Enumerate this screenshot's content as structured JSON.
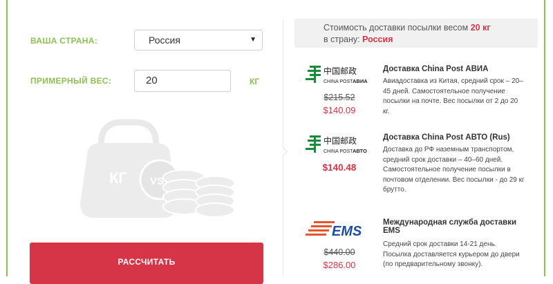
{
  "form": {
    "country_label": "ВАША СТРАНА:",
    "country_value": "Россия",
    "weight_label": "ПРИМЕРНЫЙ ВЕС:",
    "weight_value": "20",
    "weight_unit": "КГ",
    "calculate_label": "РАССЧИТАТЬ",
    "illustration": {
      "kg_text": "КГ",
      "vs_text": "VS"
    }
  },
  "summary": {
    "line1_prefix": "Стоимость доставки посылки весом",
    "weight": "20 кг",
    "line2_prefix": "в страну:",
    "country": "Россия"
  },
  "offers": [
    {
      "logo_cn": "中国邮政",
      "logo_sub": "CHINA POST",
      "logo_tag": "АВИА",
      "old_price": "$215.52",
      "price": "$140.09",
      "title": "Доставка China Post АВИА",
      "description": "Авиадоставка из Китая, средний срок – 20–45 дней. Самостоятельное получение посылки на почте. Вес посылки от 2 до 20 кг."
    },
    {
      "logo_cn": "中国邮政",
      "logo_sub": "CHINA POST",
      "logo_tag": "АВТО",
      "price": "$140.48",
      "title": "Доставка China Post АВТО (Rus)",
      "description": "Доставка до РФ наземным транспортом, средний срок доставки – 40–60 дней. Самостоятельное получение посылки в почтовом отделении. Вес посылки - до 29 кг брутто."
    },
    {
      "logo_text": "EMS",
      "old_price": "$440.00",
      "price": "$286.00",
      "title": "Международная служба доставки EMS",
      "description": "Средний срок доставки 14-21 день. Посылка доставляется курьером до двери (по предварительному звонку)."
    }
  ],
  "colors": {
    "accent_green": "#8cc152",
    "accent_red": "#d63447",
    "summary_bg": "#f1f1f1"
  }
}
